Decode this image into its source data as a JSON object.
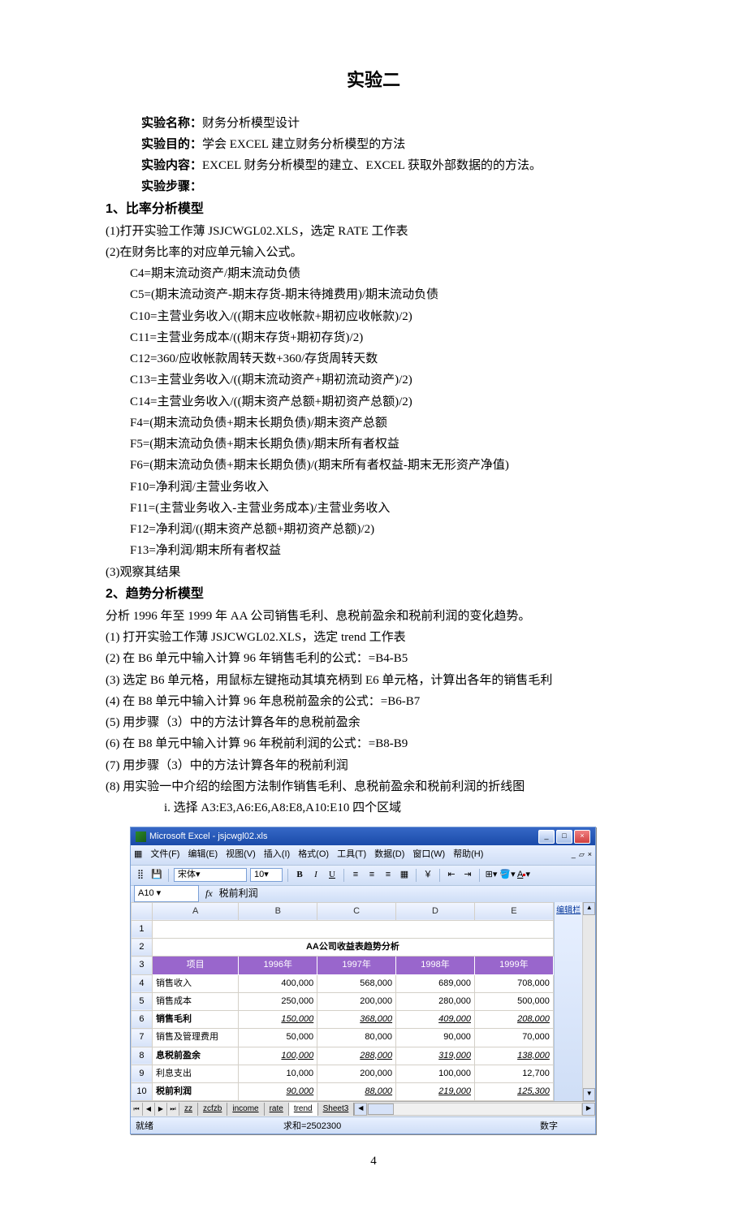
{
  "title": "实验二",
  "labels": {
    "name_label": "实验名称：",
    "name_value": "财务分析模型设计",
    "goal_label": "实验目的：",
    "goal_value": "学会 EXCEL 建立财务分析模型的方法",
    "content_label": "实验内容：",
    "content_value": "EXCEL 财务分析模型的建立、EXCEL 获取外部数据的的方法。",
    "steps_label": "实验步骤："
  },
  "section1": {
    "heading": "1、比率分析模型",
    "p1": "(1)打开实验工作薄 JSJCWGL02.XLS，选定 RATE 工作表",
    "p2": "(2)在财务比率的对应单元输入公式。",
    "formulas": [
      "C4=期末流动资产/期末流动负债",
      "C5=(期末流动资产-期末存货-期末待摊费用)/期末流动负债",
      "C10=主营业务收入/((期末应收帐款+期初应收帐款)/2)",
      "C11=主营业务成本/((期末存货+期初存货)/2)",
      "C12=360/应收帐款周转天数+360/存货周转天数",
      "C13=主营业务收入/((期末流动资产+期初流动资产)/2)",
      "C14=主营业务收入/((期末资产总额+期初资产总额)/2)",
      "F4=(期末流动负债+期末长期负债)/期末资产总额",
      "F5=(期末流动负债+期末长期负债)/期末所有者权益",
      "F6=(期末流动负债+期末长期负债)/(期末所有者权益-期末无形资产净值)",
      "F10=净利润/主营业务收入",
      "F11=(主营业务收入-主营业务成本)/主营业务收入",
      "F12=净利润/((期末资产总额+期初资产总额)/2)",
      "F13=净利润/期末所有者权益"
    ],
    "p3": "(3)观察其结果"
  },
  "section2": {
    "heading": "2、趋势分析模型",
    "intro": "分析 1996 年至 1999 年 AA 公司销售毛利、息税前盈余和税前利润的变化趋势。",
    "items": [
      "(1) 打开实验工作薄 JSJCWGL02.XLS，选定 trend 工作表",
      "(2) 在 B6 单元中输入计算 96 年销售毛利的公式：=B4-B5",
      "(3) 选定 B6 单元格，用鼠标左键拖动其填充柄到 E6 单元格，计算出各年的销售毛利",
      "(4) 在 B8 单元中输入计算 96 年息税前盈余的公式：=B6-B7",
      "(5) 用步骤（3）中的方法计算各年的息税前盈余",
      "(6) 在 B8 单元中输入计算 96 年税前利润的公式：=B8-B9",
      "(7) 用步骤（3）中的方法计算各年的税前利润",
      "(8) 用实验一中介绍的绘图方法制作销售毛利、息税前盈余和税前利润的折线图"
    ],
    "sub_i": "i. 选择 A3:E3,A6:E6,A8:E8,A10:E10 四个区域"
  },
  "excel": {
    "title": "Microsoft Excel - jsjcwgl02.xls",
    "menus": {
      "file": "文件(F)",
      "edit": "编辑(E)",
      "view": "视图(V)",
      "insert": "插入(I)",
      "format": "格式(O)",
      "tools": "工具(T)",
      "data": "数据(D)",
      "window": "窗口(W)",
      "help": "帮助(H)"
    },
    "font_name": "宋体",
    "font_size": "10",
    "namebox": "A10",
    "formula_bar": "税前利润",
    "side_label": "编辑栏",
    "cols": [
      "A",
      "B",
      "C",
      "D",
      "E"
    ],
    "table_title": "AA公司收益表趋势分析",
    "headers": {
      "item": "项目",
      "y96": "1996年",
      "y97": "1997年",
      "y98": "1998年",
      "y99": "1999年"
    },
    "rows": [
      {
        "n": "4",
        "label": "销售收入",
        "bold": false,
        "v": [
          "400,000",
          "568,000",
          "689,000",
          "708,000"
        ]
      },
      {
        "n": "5",
        "label": "销售成本",
        "bold": false,
        "v": [
          "250,000",
          "200,000",
          "280,000",
          "500,000"
        ]
      },
      {
        "n": "6",
        "label": "销售毛利",
        "bold": true,
        "v": [
          "150,000",
          "368,000",
          "409,000",
          "208,000"
        ]
      },
      {
        "n": "7",
        "label": "销售及管理费用",
        "bold": false,
        "v": [
          "50,000",
          "80,000",
          "90,000",
          "70,000"
        ]
      },
      {
        "n": "8",
        "label": "息税前盈余",
        "bold": true,
        "v": [
          "100,000",
          "288,000",
          "319,000",
          "138,000"
        ]
      },
      {
        "n": "9",
        "label": "利息支出",
        "bold": false,
        "v": [
          "10,000",
          "200,000",
          "100,000",
          "12,700"
        ]
      },
      {
        "n": "10",
        "label": "税前利润",
        "bold": true,
        "v": [
          "90,000",
          "88,000",
          "219,000",
          "125,300"
        ]
      }
    ],
    "tabs": [
      "zz",
      "zcfzb",
      "income",
      "rate",
      "trend",
      "Sheet3"
    ],
    "active_tab": "trend",
    "status": {
      "ready": "就绪",
      "sum": "求和=2502300",
      "mode": "数字"
    }
  },
  "chart_data": {
    "type": "table",
    "title": "AA公司收益表趋势分析",
    "categories": [
      "1996年",
      "1997年",
      "1998年",
      "1999年"
    ],
    "series": [
      {
        "name": "销售收入",
        "values": [
          400000,
          568000,
          689000,
          708000
        ]
      },
      {
        "name": "销售成本",
        "values": [
          250000,
          200000,
          280000,
          500000
        ]
      },
      {
        "name": "销售毛利",
        "values": [
          150000,
          368000,
          409000,
          208000
        ]
      },
      {
        "name": "销售及管理费用",
        "values": [
          50000,
          80000,
          90000,
          70000
        ]
      },
      {
        "name": "息税前盈余",
        "values": [
          100000,
          288000,
          319000,
          138000
        ]
      },
      {
        "name": "利息支出",
        "values": [
          10000,
          200000,
          100000,
          12700
        ]
      },
      {
        "name": "税前利润",
        "values": [
          90000,
          88000,
          219000,
          125300
        ]
      }
    ]
  },
  "page_number": "4"
}
